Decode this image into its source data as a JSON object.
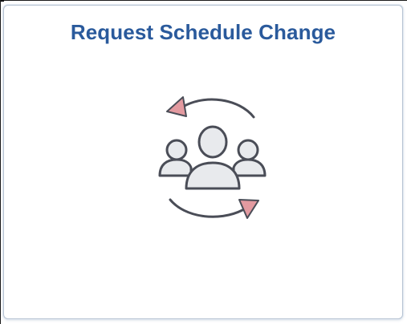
{
  "tile": {
    "title": "Request Schedule Change",
    "icon": "group-exchange-icon"
  },
  "colors": {
    "title": "#2a5a9c",
    "arrow_head": "#e39aa0",
    "icon_stroke": "#4a4d57",
    "icon_fill": "#e8eaed"
  }
}
